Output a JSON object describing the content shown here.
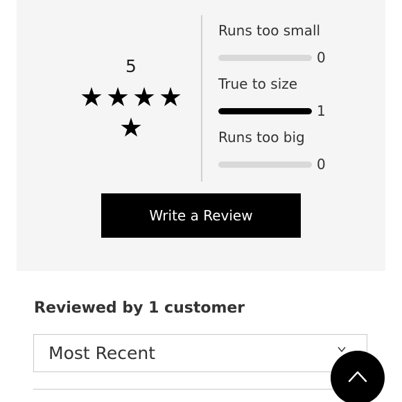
{
  "rating": {
    "value": "5",
    "stars": 5,
    "star_glyph": "★"
  },
  "fit": [
    {
      "label": "Runs too small",
      "count": "0",
      "fraction": 0
    },
    {
      "label": "True to size",
      "count": "1",
      "fraction": 1
    },
    {
      "label": "Runs too big",
      "count": "0",
      "fraction": 0
    }
  ],
  "write_review_label": "Write a Review",
  "reviews_heading": "Reviewed by 1 customer",
  "sort": {
    "selected": "Most Recent"
  },
  "icons": {
    "sort": "chevron-down-icon",
    "scroll_top": "chevron-up-icon"
  },
  "colors": {
    "panel_background": "#f5f5f5",
    "button_background": "#000000",
    "bar_track": "#d9d9d9",
    "bar_fill": "#000000"
  }
}
